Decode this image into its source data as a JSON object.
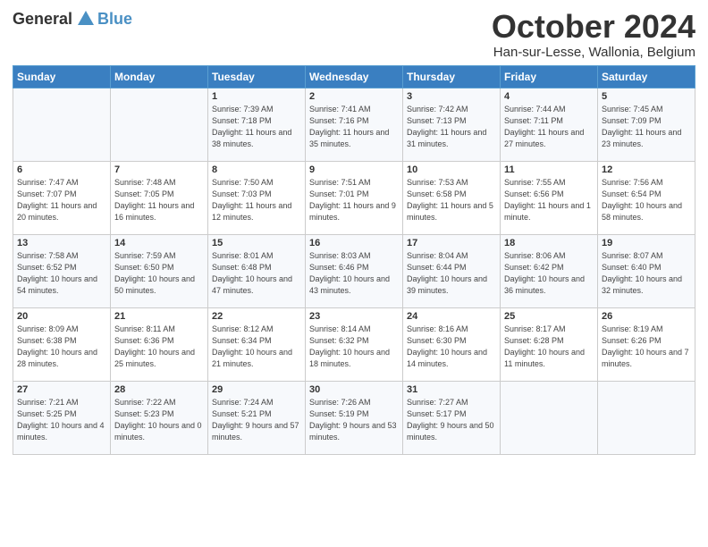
{
  "header": {
    "logo_general": "General",
    "logo_blue": "Blue",
    "month": "October 2024",
    "location": "Han-sur-Lesse, Wallonia, Belgium"
  },
  "weekdays": [
    "Sunday",
    "Monday",
    "Tuesday",
    "Wednesday",
    "Thursday",
    "Friday",
    "Saturday"
  ],
  "weeks": [
    [
      {
        "day": "",
        "info": ""
      },
      {
        "day": "",
        "info": ""
      },
      {
        "day": "1",
        "info": "Sunrise: 7:39 AM\nSunset: 7:18 PM\nDaylight: 11 hours and 38 minutes."
      },
      {
        "day": "2",
        "info": "Sunrise: 7:41 AM\nSunset: 7:16 PM\nDaylight: 11 hours and 35 minutes."
      },
      {
        "day": "3",
        "info": "Sunrise: 7:42 AM\nSunset: 7:13 PM\nDaylight: 11 hours and 31 minutes."
      },
      {
        "day": "4",
        "info": "Sunrise: 7:44 AM\nSunset: 7:11 PM\nDaylight: 11 hours and 27 minutes."
      },
      {
        "day": "5",
        "info": "Sunrise: 7:45 AM\nSunset: 7:09 PM\nDaylight: 11 hours and 23 minutes."
      }
    ],
    [
      {
        "day": "6",
        "info": "Sunrise: 7:47 AM\nSunset: 7:07 PM\nDaylight: 11 hours and 20 minutes."
      },
      {
        "day": "7",
        "info": "Sunrise: 7:48 AM\nSunset: 7:05 PM\nDaylight: 11 hours and 16 minutes."
      },
      {
        "day": "8",
        "info": "Sunrise: 7:50 AM\nSunset: 7:03 PM\nDaylight: 11 hours and 12 minutes."
      },
      {
        "day": "9",
        "info": "Sunrise: 7:51 AM\nSunset: 7:01 PM\nDaylight: 11 hours and 9 minutes."
      },
      {
        "day": "10",
        "info": "Sunrise: 7:53 AM\nSunset: 6:58 PM\nDaylight: 11 hours and 5 minutes."
      },
      {
        "day": "11",
        "info": "Sunrise: 7:55 AM\nSunset: 6:56 PM\nDaylight: 11 hours and 1 minute."
      },
      {
        "day": "12",
        "info": "Sunrise: 7:56 AM\nSunset: 6:54 PM\nDaylight: 10 hours and 58 minutes."
      }
    ],
    [
      {
        "day": "13",
        "info": "Sunrise: 7:58 AM\nSunset: 6:52 PM\nDaylight: 10 hours and 54 minutes."
      },
      {
        "day": "14",
        "info": "Sunrise: 7:59 AM\nSunset: 6:50 PM\nDaylight: 10 hours and 50 minutes."
      },
      {
        "day": "15",
        "info": "Sunrise: 8:01 AM\nSunset: 6:48 PM\nDaylight: 10 hours and 47 minutes."
      },
      {
        "day": "16",
        "info": "Sunrise: 8:03 AM\nSunset: 6:46 PM\nDaylight: 10 hours and 43 minutes."
      },
      {
        "day": "17",
        "info": "Sunrise: 8:04 AM\nSunset: 6:44 PM\nDaylight: 10 hours and 39 minutes."
      },
      {
        "day": "18",
        "info": "Sunrise: 8:06 AM\nSunset: 6:42 PM\nDaylight: 10 hours and 36 minutes."
      },
      {
        "day": "19",
        "info": "Sunrise: 8:07 AM\nSunset: 6:40 PM\nDaylight: 10 hours and 32 minutes."
      }
    ],
    [
      {
        "day": "20",
        "info": "Sunrise: 8:09 AM\nSunset: 6:38 PM\nDaylight: 10 hours and 28 minutes."
      },
      {
        "day": "21",
        "info": "Sunrise: 8:11 AM\nSunset: 6:36 PM\nDaylight: 10 hours and 25 minutes."
      },
      {
        "day": "22",
        "info": "Sunrise: 8:12 AM\nSunset: 6:34 PM\nDaylight: 10 hours and 21 minutes."
      },
      {
        "day": "23",
        "info": "Sunrise: 8:14 AM\nSunset: 6:32 PM\nDaylight: 10 hours and 18 minutes."
      },
      {
        "day": "24",
        "info": "Sunrise: 8:16 AM\nSunset: 6:30 PM\nDaylight: 10 hours and 14 minutes."
      },
      {
        "day": "25",
        "info": "Sunrise: 8:17 AM\nSunset: 6:28 PM\nDaylight: 10 hours and 11 minutes."
      },
      {
        "day": "26",
        "info": "Sunrise: 8:19 AM\nSunset: 6:26 PM\nDaylight: 10 hours and 7 minutes."
      }
    ],
    [
      {
        "day": "27",
        "info": "Sunrise: 7:21 AM\nSunset: 5:25 PM\nDaylight: 10 hours and 4 minutes."
      },
      {
        "day": "28",
        "info": "Sunrise: 7:22 AM\nSunset: 5:23 PM\nDaylight: 10 hours and 0 minutes."
      },
      {
        "day": "29",
        "info": "Sunrise: 7:24 AM\nSunset: 5:21 PM\nDaylight: 9 hours and 57 minutes."
      },
      {
        "day": "30",
        "info": "Sunrise: 7:26 AM\nSunset: 5:19 PM\nDaylight: 9 hours and 53 minutes."
      },
      {
        "day": "31",
        "info": "Sunrise: 7:27 AM\nSunset: 5:17 PM\nDaylight: 9 hours and 50 minutes."
      },
      {
        "day": "",
        "info": ""
      },
      {
        "day": "",
        "info": ""
      }
    ]
  ]
}
